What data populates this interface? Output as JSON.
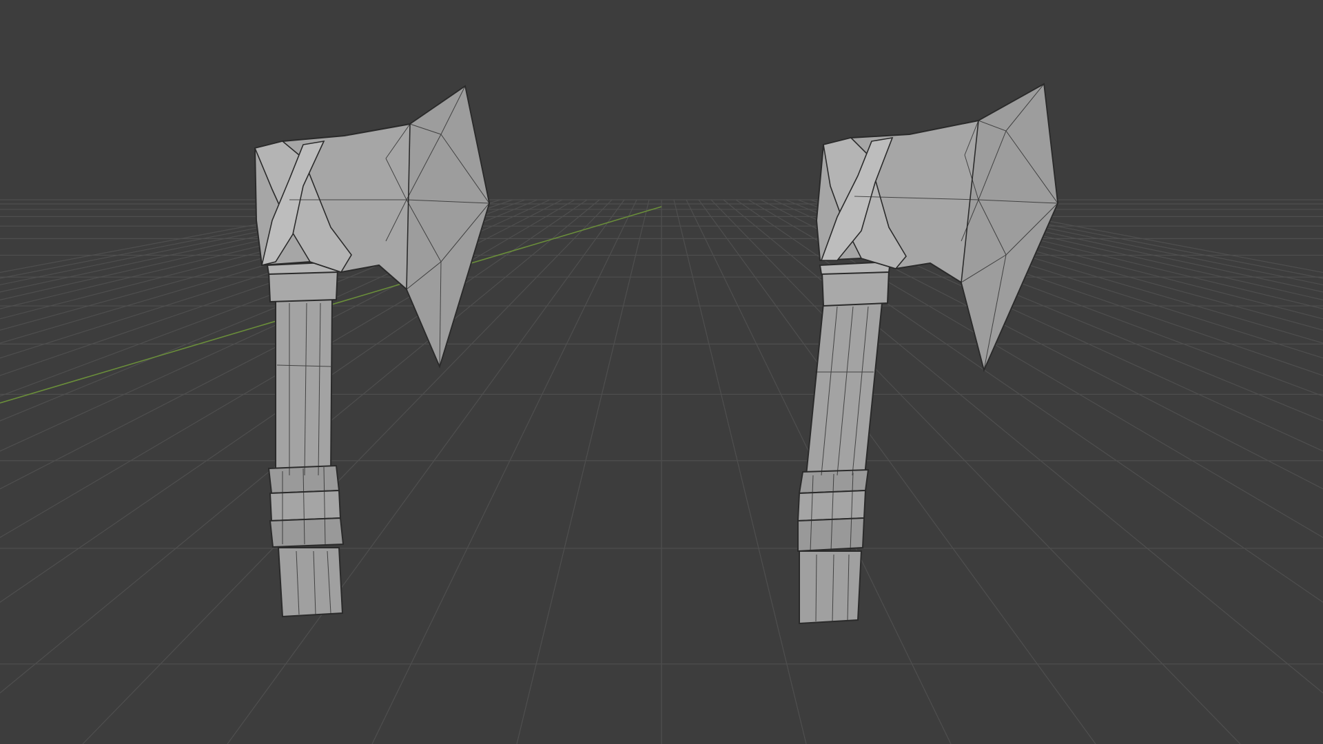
{
  "viewport": {
    "view": "3D Viewport",
    "background_color": "#3d3d3d",
    "grid_color": "#4f4f4f",
    "grid_minor_color": "#464646",
    "x_axis_color": "#8a3a3a",
    "y_axis_color": "#6a8e3a",
    "overlays": {
      "grid_floor": true,
      "axis_y": true
    }
  },
  "scene": {
    "objects": [
      {
        "name": "axe-left",
        "shading": "solid",
        "wireframe_overlay": true,
        "mesh_color": "#9c9c9c"
      },
      {
        "name": "axe-right",
        "shading": "solid",
        "wireframe_overlay": true,
        "mesh_color": "#9c9c9c"
      }
    ]
  },
  "icons": {
    "axe": "axe-mesh-icon"
  }
}
